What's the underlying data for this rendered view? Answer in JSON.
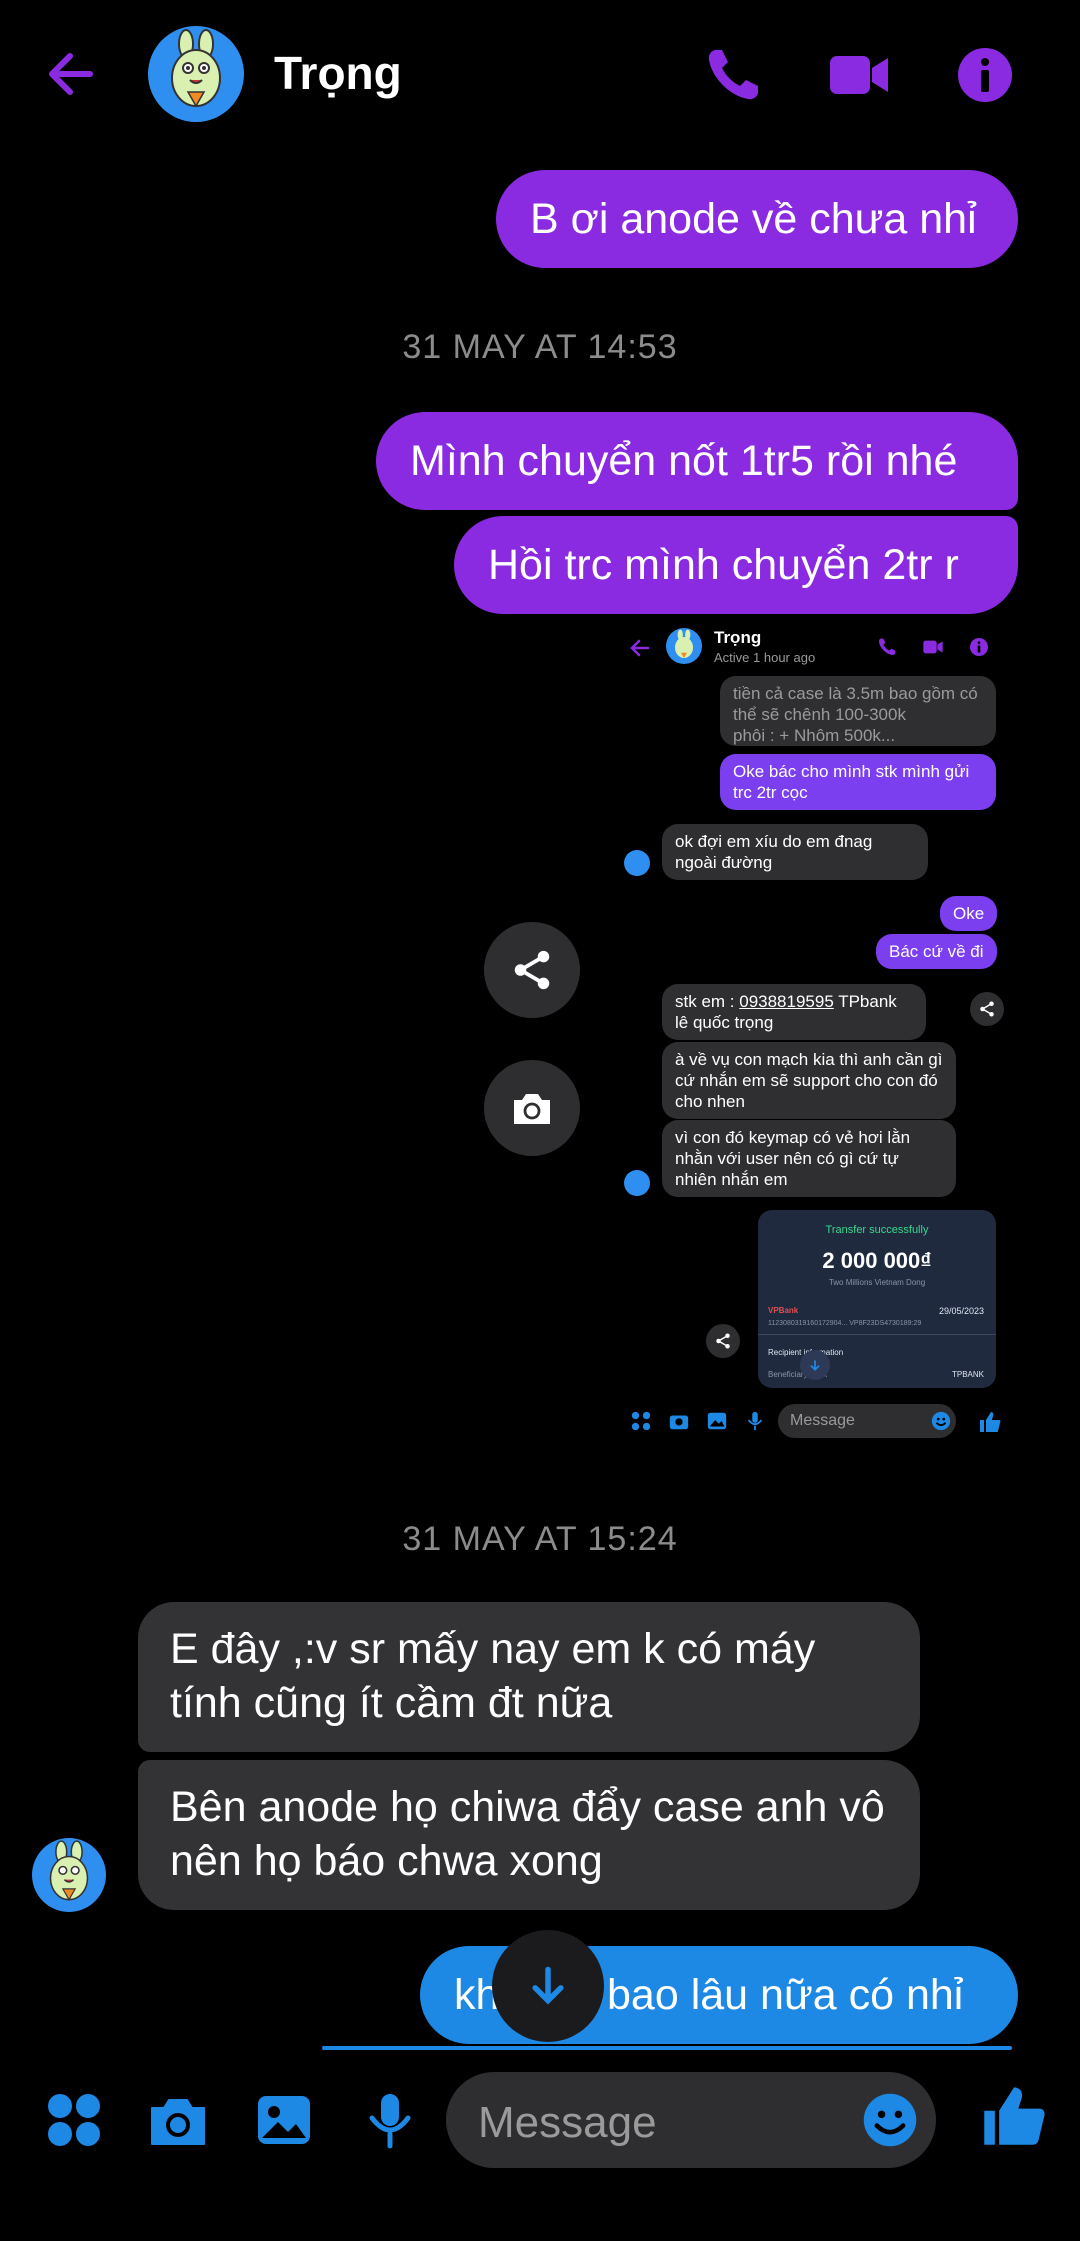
{
  "header": {
    "name": "Trọng"
  },
  "messages": {
    "m1": "B ơi anode về chưa nhỉ",
    "ts1": "31 MAY AT 14:53",
    "m2": "Mình chuyển nốt 1tr5 rồi nhé",
    "m3": "Hồi trc mình chuyển 2tr r",
    "ts2": "31 MAY AT 15:24",
    "m4": "E đây ,:v  sr mấy nay em k có máy tính cũng ít cầm đt nữa",
    "m5": "Bên anode họ chiwa đẩy case anh vô nên họ báo chwa xong",
    "m6": "khoảng bao lâu nữa có nhỉ"
  },
  "screenshot": {
    "name": "Trọng",
    "status": "Active 1 hour ago",
    "b1": "tiền cả case là 3.5m bao gồm có thể sẽ chênh 100-300k\n phôi : + Nhôm 500k...",
    "b2": "Oke bác cho mình stk mình gửi trc 2tr cọc",
    "b3": "ok đợi em xíu do em đnag ngoài đường",
    "b4": "Oke",
    "b5": "Bác cứ về đi",
    "b6_pre": "stk em : ",
    "b6_num": "0938819595",
    "b6_post": " TPbank lê quốc trọng",
    "b7": "à về vụ con mạch kia thì anh cần gì cứ nhắn em sẽ support cho con đó cho nhen",
    "b8": "vì con đó keymap có vẻ hơi lằn nhằn với user nên có gì cứ tự nhiên nhắn em",
    "transfer_status": "Transfer successfully",
    "transfer_amount": "2 000 000₫",
    "transfer_words": "Two Millions Vietnam Dong",
    "bank_from": "VPBank",
    "date": "29/05/2023",
    "account_line": "1123080319160172904...  VP8F23DS4730189:29",
    "recipient_label": "Recipient information",
    "beneficiary_label": "Beneficiary bank",
    "beneficiary_value": "TPBANK",
    "composer_placeholder": "Message"
  },
  "composer": {
    "placeholder": "Message"
  },
  "colors": {
    "accent_purple": "#8a2be2",
    "accent_blue": "#1e88e5",
    "incoming_bubble": "#333336",
    "background": "#000000"
  }
}
